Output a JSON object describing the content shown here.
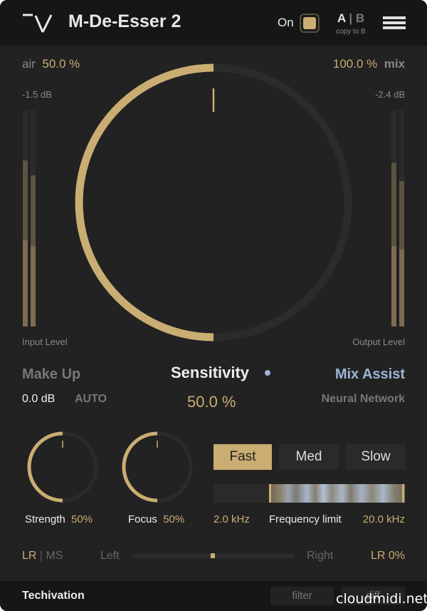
{
  "header": {
    "title": "M-De-Esser 2",
    "on_label": "On",
    "on_state": true,
    "ab_a": "A",
    "ab_sep": "|",
    "ab_b": "B",
    "copy_label": "copy to B"
  },
  "air": {
    "label": "air",
    "value": "50.0 %"
  },
  "mix": {
    "label": "mix",
    "value": "100.0 %"
  },
  "input_meter": {
    "peak": "-1.5 dB",
    "label": "Input Level"
  },
  "output_meter": {
    "peak": "-2.4 dB",
    "label": "Output Level"
  },
  "sensitivity": {
    "label": "Sensitivity",
    "value": "50.0 %",
    "fraction": 0.5
  },
  "makeup": {
    "label": "Make Up",
    "value": "0.0 dB",
    "auto": "AUTO"
  },
  "mix_assist": {
    "label": "Mix Assist",
    "sub": "Neural Network"
  },
  "strength": {
    "label": "Strength",
    "value": "50%",
    "fraction": 0.5
  },
  "focus": {
    "label": "Focus",
    "value": "50%",
    "fraction": 0.5
  },
  "speed": {
    "options": [
      "Fast",
      "Med",
      "Slow"
    ],
    "selected": "Fast"
  },
  "frequency": {
    "low": "2.0 kHz",
    "label": "Frequency limit",
    "high": "20.0 kHz"
  },
  "stereo": {
    "lr": "LR",
    "sep": "|",
    "ms": "MS",
    "left": "Left",
    "right": "Right",
    "value": "LR 0%"
  },
  "footer": {
    "brand": "Techivation",
    "filter": "filter",
    "diff": "diff",
    "watermark": "cloudmidi.net"
  },
  "colors": {
    "accent": "#c9ad72",
    "assist": "#9fb4d8",
    "background": "#222222"
  }
}
